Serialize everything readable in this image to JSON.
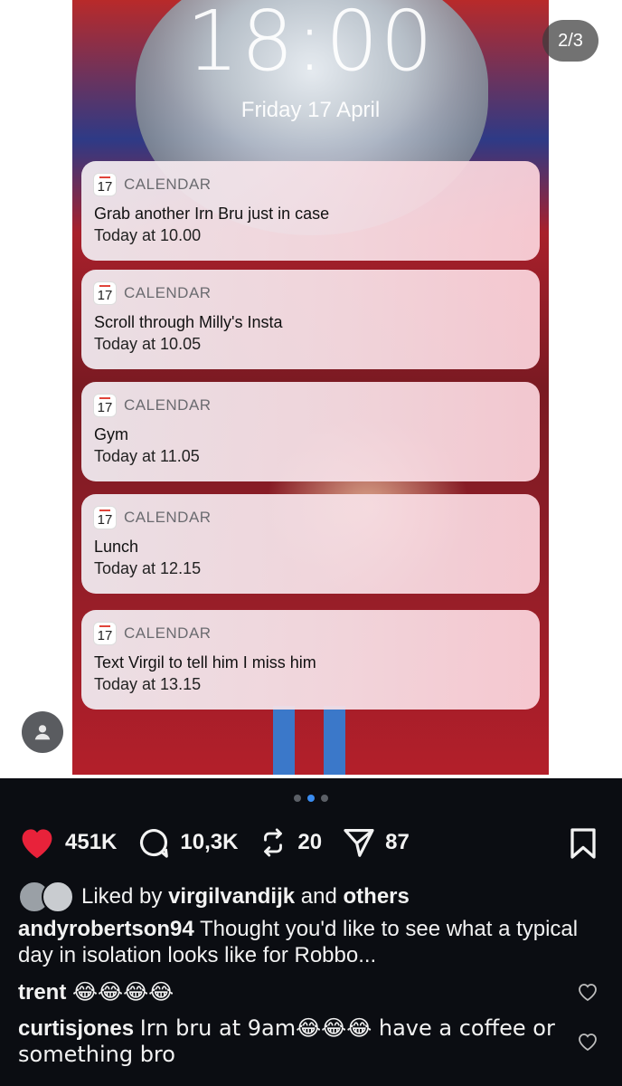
{
  "media": {
    "counter": "2/3",
    "lockscreen": {
      "time": "18:00",
      "date": "Friday 17 April",
      "notifications": [
        {
          "icon_day": "17",
          "app": "CALENDAR",
          "title": "Grab another Irn Bru just in case",
          "time": "Today at 10.00"
        },
        {
          "icon_day": "17",
          "app": "CALENDAR",
          "title": "Scroll through Milly's Insta",
          "time": "Today at 10.05"
        },
        {
          "icon_day": "17",
          "app": "CALENDAR",
          "title": "Gym",
          "time": "Today at 11.05"
        },
        {
          "icon_day": "17",
          "app": "CALENDAR",
          "title": "Lunch",
          "time": "Today at 12.15"
        },
        {
          "icon_day": "17",
          "app": "CALENDAR",
          "title": "Text Virgil to tell him I miss him",
          "time": "Today at 13.15"
        }
      ]
    },
    "carousel": {
      "total": 3,
      "active_index": 1
    }
  },
  "actions": {
    "likes": "451K",
    "comments": "10,3K",
    "reposts": "20",
    "shares": "87",
    "like_color": "#e8223a"
  },
  "liked_by": {
    "prefix": "Liked by",
    "user": "virgilvandijk",
    "conj": "and",
    "others": "others"
  },
  "caption": {
    "user": "andyrobertson94",
    "text": "Thought you'd like to see what a typical day in isolation looks like for Robbo..."
  },
  "comments": [
    {
      "user": "trent",
      "text": "😂😂😂😂"
    },
    {
      "user": "curtisjones",
      "text": "Irn bru at 9am😂😂😂 have a coffee or something bro"
    }
  ],
  "icons": {
    "like": "heart-icon",
    "comment": "comment-bubble-icon",
    "repost": "repost-icon",
    "share": "send-icon",
    "save": "bookmark-icon",
    "profile": "person-icon"
  }
}
